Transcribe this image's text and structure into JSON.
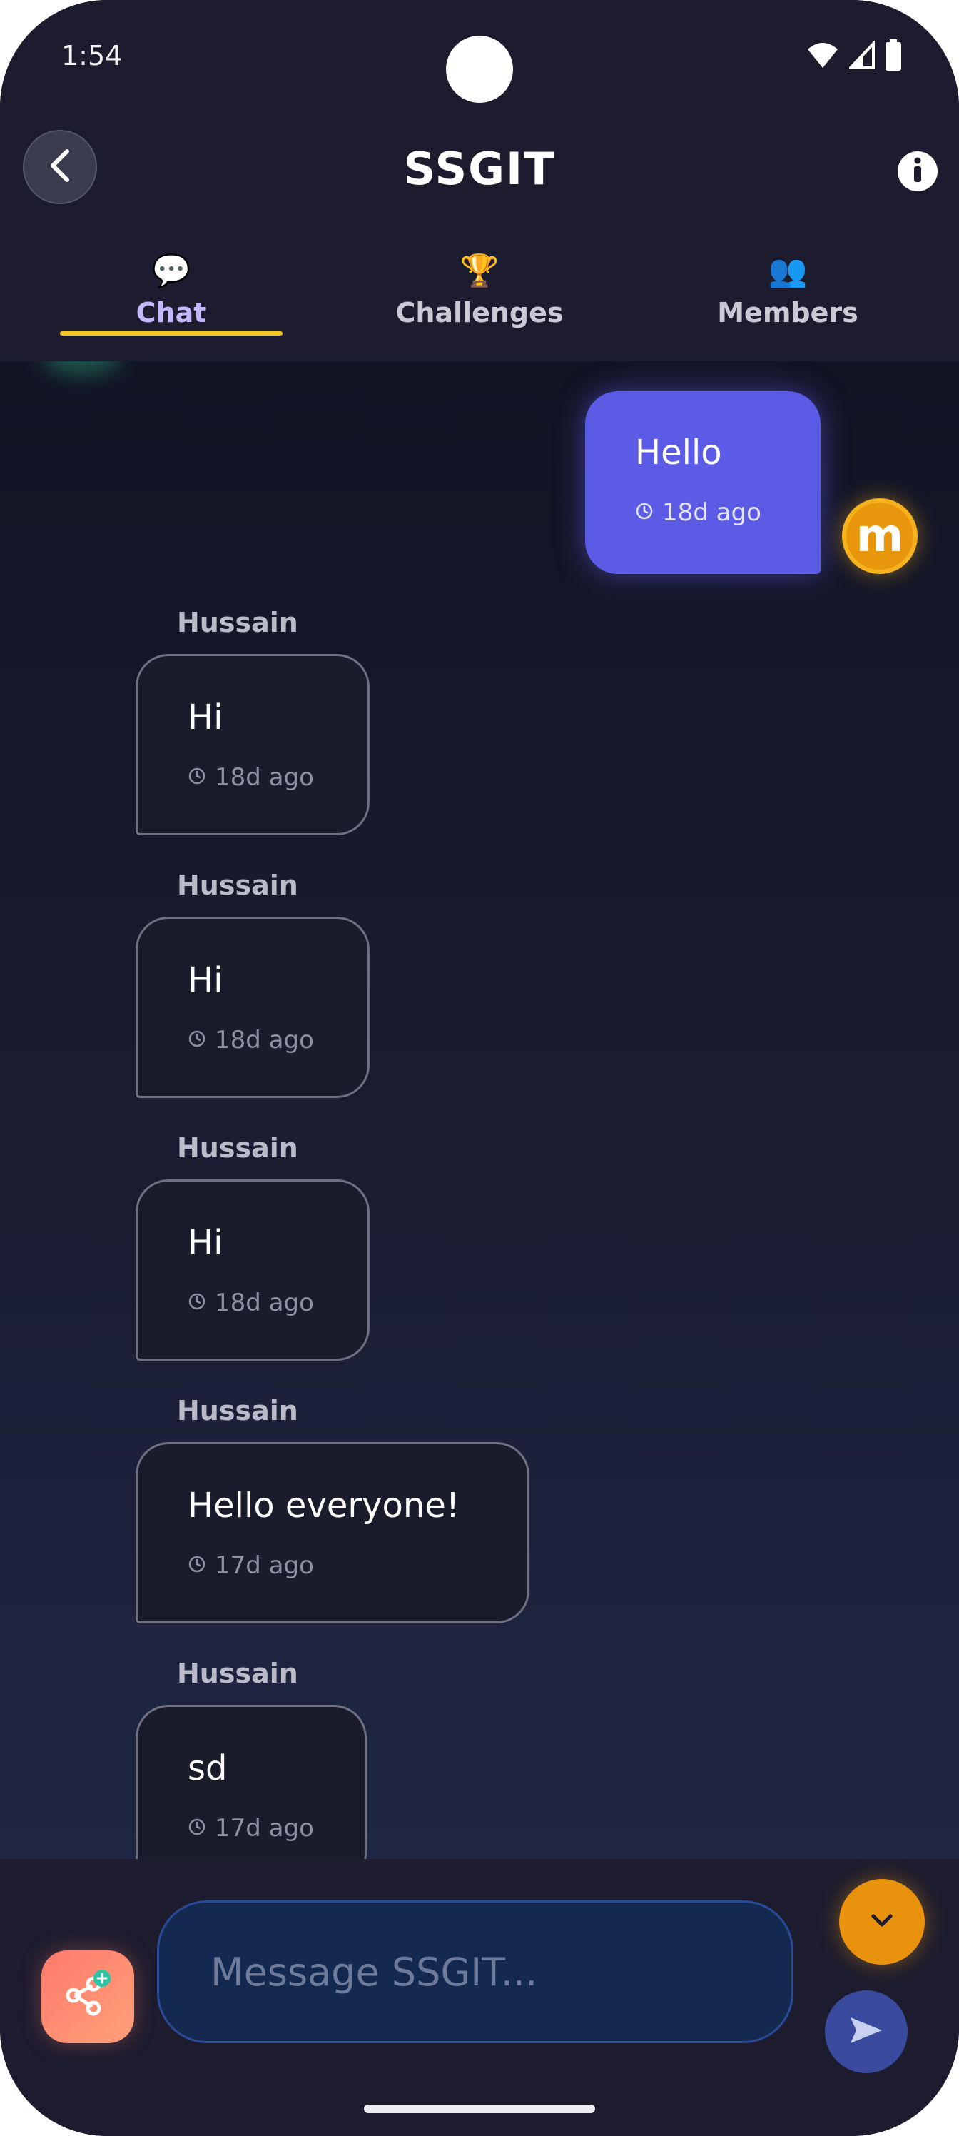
{
  "status_bar": {
    "time": "1:54"
  },
  "header": {
    "title": "SSGIT"
  },
  "tabs": [
    {
      "label": "Chat",
      "icon": "💬"
    },
    {
      "label": "Challenges",
      "icon": "🏆"
    },
    {
      "label": "Members",
      "icon": "👥"
    }
  ],
  "messages": [
    {
      "sender": "",
      "text": "Hello",
      "time": "18d ago",
      "outgoing": true,
      "avatar": "m"
    },
    {
      "sender": "Hussain",
      "text": "Hi",
      "time": "18d ago"
    },
    {
      "sender": "Hussain",
      "text": "Hi",
      "time": "18d ago"
    },
    {
      "sender": "Hussain",
      "text": "Hi",
      "time": "18d ago"
    },
    {
      "sender": "Hussain",
      "text": "Hello everyone!",
      "time": "17d ago"
    },
    {
      "sender": "Hussain",
      "text": "sd",
      "time": "17d ago"
    }
  ],
  "composer": {
    "placeholder": "Message SSGIT..."
  },
  "colors": {
    "accent": "#5b5be6",
    "tab_underline": "#f3c623",
    "avatar": "#e8960c",
    "share": "#ff7a6a",
    "scroll_down": "#e8920e"
  }
}
